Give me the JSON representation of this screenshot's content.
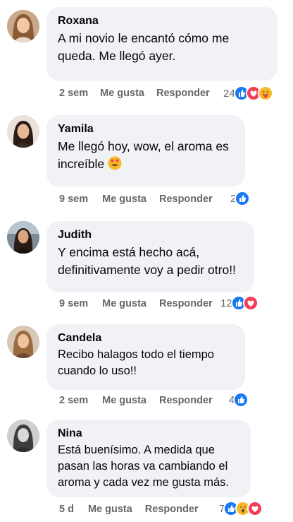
{
  "comments": [
    {
      "name": "Roxana",
      "text": "A mi novio le encantó cómo me queda. Me llegó ayer.",
      "time": "2 sem",
      "like": "Me gusta",
      "reply": "Responder",
      "reaction_count": "24",
      "reactions": [
        "like-icon",
        "love-icon",
        "care-icon"
      ]
    },
    {
      "name": "Yamila",
      "text": "Me llegó hoy, wow, el aroma es increíble",
      "emoji": "heart-eyes-emoji-icon",
      "time": "9 sem",
      "like": "Me gusta",
      "reply": "Responder",
      "reaction_count": "2",
      "reactions": [
        "like-icon"
      ]
    },
    {
      "name": "Judith",
      "text": "Y encima está hecho acá, definitivamente voy a pedir otro!!",
      "time": "9 sem",
      "like": "Me gusta",
      "reply": "Responder",
      "reaction_count": "12",
      "reactions": [
        "like-icon",
        "love-icon"
      ]
    },
    {
      "name": "Candela",
      "text": "Recibo halagos todo el tiempo cuando lo uso!!",
      "time": "2 sem",
      "like": "Me gusta",
      "reply": "Responder",
      "reaction_count": "4",
      "reactions": [
        "like-icon"
      ]
    },
    {
      "name": "Nina",
      "text": "Está buenísimo. A medida que pasan las horas va cambiando el aroma y cada vez me gusta más.",
      "time": "5 d",
      "like": "Me gusta",
      "reply": "Responder",
      "reaction_count": "7",
      "reactions": [
        "like-icon",
        "wow-icon",
        "love-icon"
      ]
    }
  ],
  "colors": {
    "bubble": "#f0f2f5",
    "meta_text": "#65676b",
    "like_blue": "#1877f2",
    "love_red": "#f33e58",
    "emoji_yellow": "#f7b928"
  }
}
